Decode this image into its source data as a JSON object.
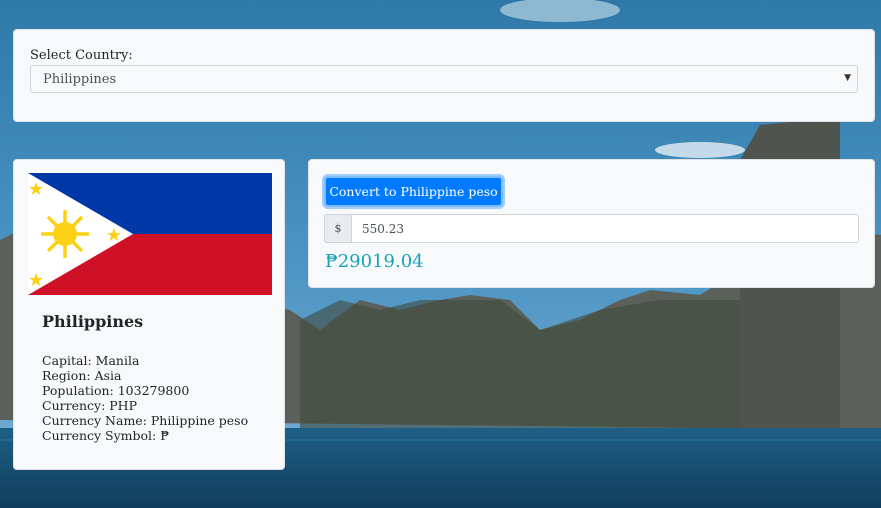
{
  "selector": {
    "label": "Select Country:",
    "selected": "Philippines"
  },
  "country": {
    "name": "Philippines",
    "flag": "philippines-flag",
    "info": [
      "Capital: Manila",
      "Region: Asia",
      "Population: 103279800",
      "Currency: PHP",
      "Currency Name: Philippine peso",
      "Currency Symbol: ₱"
    ]
  },
  "converter": {
    "button_label": "Convert to Philippine peso",
    "prefix": "$",
    "amount": "550.23",
    "result": "₱29019.04"
  },
  "colors": {
    "accent": "#007bff",
    "result": "#17a2b8",
    "flag_blue": "#0038a8",
    "flag_red": "#ce1126",
    "flag_yellow": "#fcd116"
  }
}
